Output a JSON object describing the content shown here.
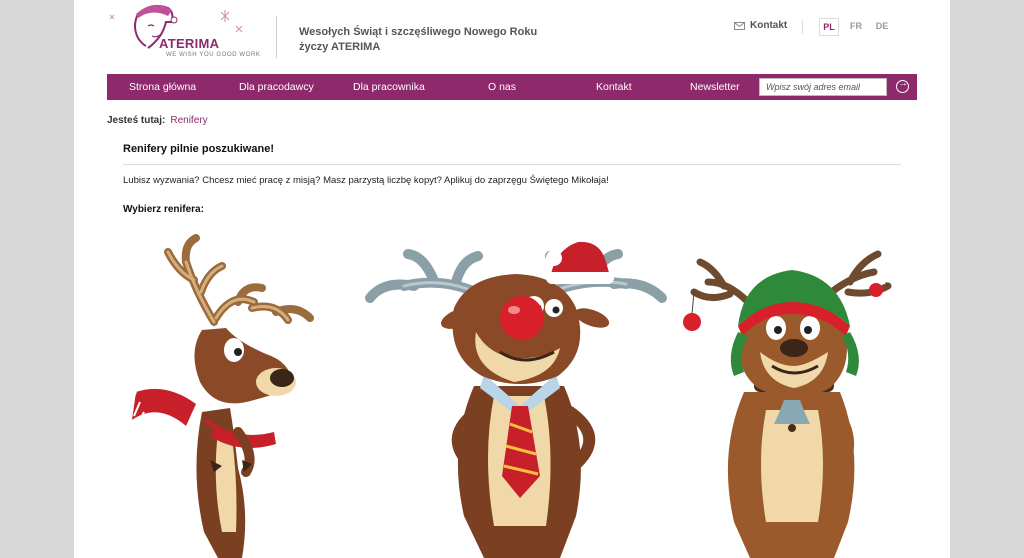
{
  "header": {
    "logo_text": "ATERIMA",
    "logo_tagline": "WE WISH YOU GOOD WORK",
    "greeting_line1": "Wesołych Świąt i szczęśliwego Nowego Roku",
    "greeting_line2": "życzy ATERIMA",
    "contact_label": "Kontakt",
    "languages": [
      "PL",
      "FR",
      "DE"
    ],
    "active_language": "PL"
  },
  "nav": {
    "items": [
      "Strona główna",
      "Dla pracodawcy",
      "Dla pracownika",
      "O nas",
      "Kontakt"
    ],
    "newsletter_label": "Newsletter",
    "newsletter_placeholder": "Wpisz swój adres email"
  },
  "breadcrumb": {
    "label": "Jesteś tutaj:",
    "current": "Renifery"
  },
  "content": {
    "title": "Renifery pilnie poszukiwane!",
    "intro": "Lubisz wyzwania? Chcesz mieć pracę z misją? Masz parzystą liczbę kopyt? Aplikuj do zaprzęgu Świętego Mikołaja!",
    "choose_label": "Wybierz renifera:"
  },
  "colors": {
    "brand": "#8e2a6c",
    "background": "#d7d7d7"
  }
}
